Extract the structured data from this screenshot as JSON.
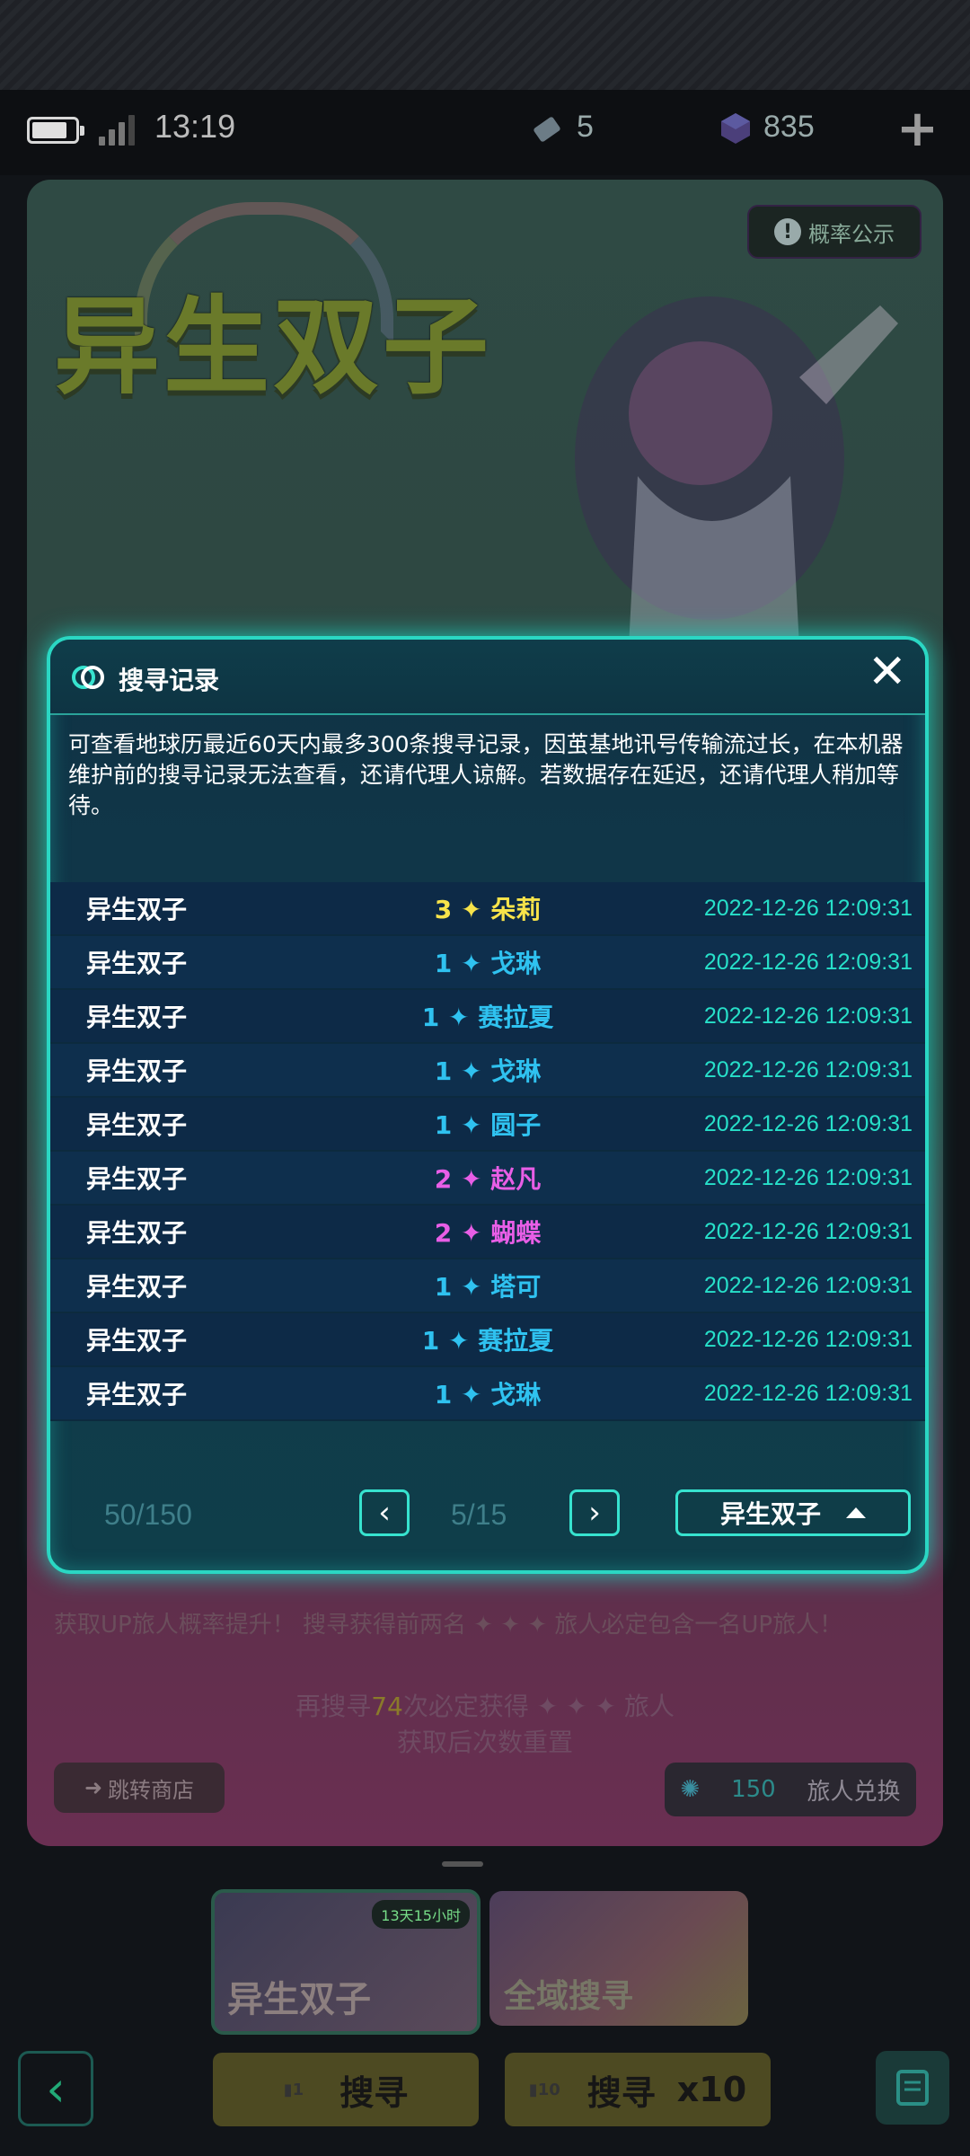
{
  "status_bar": {
    "time": "13:19",
    "tickets": "5",
    "gems": "835"
  },
  "banner": {
    "title": "异生双子",
    "probability_label": "概率公示",
    "line1": "获取UP旅人概率提升！ 搜寻获得前两名 ✦ ✦ ✦ 旅人必定包含一名UP旅人！",
    "pity_line_prefix": "再搜寻",
    "pity_count": "74",
    "pity_line_suffix": "次必定获得 ✦ ✦ ✦ 旅人",
    "pity_reset": "获取后次数重置",
    "shop_button": "跳转商店",
    "exchange_count": "150",
    "exchange_label": "旅人兑换"
  },
  "pool_tabs": [
    {
      "label": "异生双子",
      "timer": "13天15小时"
    },
    {
      "label": "全域搜寻"
    }
  ],
  "actions": {
    "search_once": "搜寻",
    "search_ten": "搜寻",
    "ten_suffix": "x10",
    "ticket_one": "1",
    "ticket_ten": "10"
  },
  "modal": {
    "title": "搜寻记录",
    "description": "可查看地球历最近60天内最多300条搜寻记录，因茧基地讯号传输流过长，在本机器维护前的搜寻记录无法查看，还请代理人谅解。若数据存在延迟，还请代理人稍加等待。",
    "records": [
      {
        "pool": "异生双子",
        "stars": "3",
        "name": "朵莉",
        "time": "2022-12-26 12:09:31"
      },
      {
        "pool": "异生双子",
        "stars": "1",
        "name": "戈琳",
        "time": "2022-12-26 12:09:31"
      },
      {
        "pool": "异生双子",
        "stars": "1",
        "name": "赛拉夏",
        "time": "2022-12-26 12:09:31"
      },
      {
        "pool": "异生双子",
        "stars": "1",
        "name": "戈琳",
        "time": "2022-12-26 12:09:31"
      },
      {
        "pool": "异生双子",
        "stars": "1",
        "name": "圆子",
        "time": "2022-12-26 12:09:31"
      },
      {
        "pool": "异生双子",
        "stars": "2",
        "name": "赵凡",
        "time": "2022-12-26 12:09:31"
      },
      {
        "pool": "异生双子",
        "stars": "2",
        "name": "蝴蝶",
        "time": "2022-12-26 12:09:31"
      },
      {
        "pool": "异生双子",
        "stars": "1",
        "name": "塔可",
        "time": "2022-12-26 12:09:31"
      },
      {
        "pool": "异生双子",
        "stars": "1",
        "name": "赛拉夏",
        "time": "2022-12-26 12:09:31"
      },
      {
        "pool": "异生双子",
        "stars": "1",
        "name": "戈琳",
        "time": "2022-12-26 12:09:31"
      }
    ],
    "record_count": "50/150",
    "page_indicator": "5/15",
    "pool_filter": "异生双子"
  },
  "colors": {
    "accent": "#2ad7c3",
    "star3": "#f7e34a",
    "star2": "#e85ee6",
    "star1": "#2fc2f0",
    "time": "#27e0c9"
  }
}
